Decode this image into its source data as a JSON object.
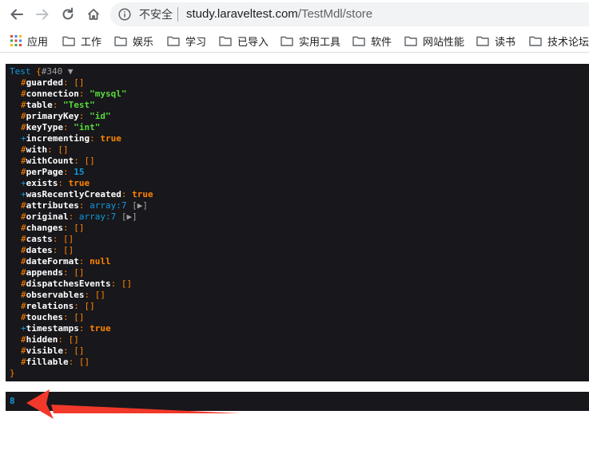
{
  "browser": {
    "insecure_label": "不安全",
    "url_host": "study.laraveltest.com",
    "url_path": "/TestMdl/store",
    "bookmarks": [
      "应用",
      "工作",
      "娱乐",
      "学习",
      "已导入",
      "实用工具",
      "软件",
      "网站性能",
      "读书",
      "技术论坛"
    ]
  },
  "dump": {
    "class_name": "Test",
    "open": " {",
    "object_id": "#340",
    "toggle": " ▼",
    "close": "}",
    "properties": [
      {
        "vis": "#",
        "name": "guarded",
        "kind": "arr",
        "value": "[]"
      },
      {
        "vis": "#",
        "name": "connection",
        "kind": "str",
        "value": "\"mysql\""
      },
      {
        "vis": "#",
        "name": "table",
        "kind": "str",
        "value": "\"Test\""
      },
      {
        "vis": "#",
        "name": "primaryKey",
        "kind": "str",
        "value": "\"id\""
      },
      {
        "vis": "#",
        "name": "keyType",
        "kind": "str",
        "value": "\"int\""
      },
      {
        "vis": "+",
        "name": "incrementing",
        "kind": "const",
        "value": "true"
      },
      {
        "vis": "#",
        "name": "with",
        "kind": "arr",
        "value": "[]"
      },
      {
        "vis": "#",
        "name": "withCount",
        "kind": "arr",
        "value": "[]"
      },
      {
        "vis": "#",
        "name": "perPage",
        "kind": "num",
        "value": "15"
      },
      {
        "vis": "+",
        "name": "exists",
        "kind": "const",
        "value": "true"
      },
      {
        "vis": "+",
        "name": "wasRecentlyCreated",
        "kind": "const",
        "value": "true"
      },
      {
        "vis": "#",
        "name": "attributes",
        "kind": "array",
        "value": "array:7",
        "toggle": "[▶]"
      },
      {
        "vis": "#",
        "name": "original",
        "kind": "array",
        "value": "array:7",
        "toggle": "[▶]"
      },
      {
        "vis": "#",
        "name": "changes",
        "kind": "arr",
        "value": "[]"
      },
      {
        "vis": "#",
        "name": "casts",
        "kind": "arr",
        "value": "[]"
      },
      {
        "vis": "#",
        "name": "dates",
        "kind": "arr",
        "value": "[]"
      },
      {
        "vis": "#",
        "name": "dateFormat",
        "kind": "const",
        "value": "null"
      },
      {
        "vis": "#",
        "name": "appends",
        "kind": "arr",
        "value": "[]"
      },
      {
        "vis": "#",
        "name": "dispatchesEvents",
        "kind": "arr",
        "value": "[]"
      },
      {
        "vis": "#",
        "name": "observables",
        "kind": "arr",
        "value": "[]"
      },
      {
        "vis": "#",
        "name": "relations",
        "kind": "arr",
        "value": "[]"
      },
      {
        "vis": "#",
        "name": "touches",
        "kind": "arr",
        "value": "[]"
      },
      {
        "vis": "+",
        "name": "timestamps",
        "kind": "const",
        "value": "true"
      },
      {
        "vis": "#",
        "name": "hidden",
        "kind": "arr",
        "value": "[]"
      },
      {
        "vis": "#",
        "name": "visible",
        "kind": "arr",
        "value": "[]"
      },
      {
        "vis": "#",
        "name": "fillable",
        "kind": "arr",
        "value": "[]"
      }
    ],
    "second_value": "8"
  },
  "colors": {
    "dump_bg": "#18171b",
    "arrow": "#f2382a"
  }
}
